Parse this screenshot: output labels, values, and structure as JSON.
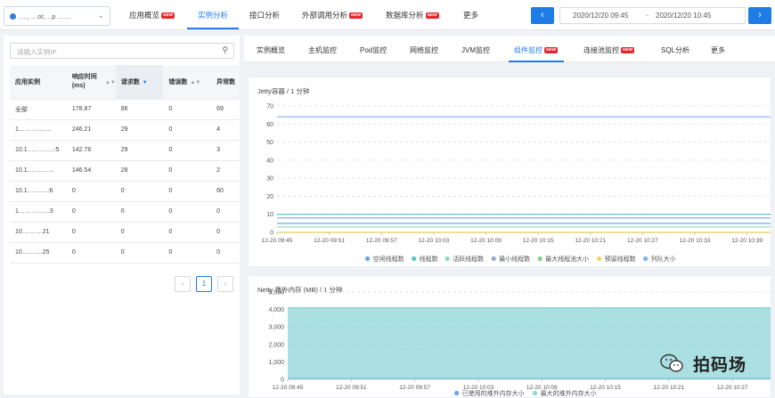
{
  "header": {
    "app_select": "…., …or,…p  ……",
    "nav": [
      {
        "label": "应用概览",
        "badge": "NEW"
      },
      {
        "label": "实例分析",
        "badge": ""
      },
      {
        "label": "接口分析",
        "badge": ""
      },
      {
        "label": "外部调用分析",
        "badge": "NEW"
      },
      {
        "label": "数据库分析",
        "badge": "NEW"
      },
      {
        "label": "更多",
        "badge": ""
      }
    ],
    "time_start": "2020/12/20 09:45",
    "time_sep": "~",
    "time_end": "2020/12/20 10:45",
    "prev_icon": "chevron-left-icon",
    "next_icon": "chevron-right-icon"
  },
  "instances": {
    "search_placeholder": "请输入实例IP",
    "columns": [
      "应用实例",
      "响应时间 (ms)",
      "请求数",
      "错误数",
      "异常数"
    ],
    "rows": [
      [
        "全部",
        "178.87",
        "86",
        "0",
        "69"
      ],
      [
        "1…………….",
        "246.21",
        "29",
        "0",
        "4"
      ],
      [
        "10.1………….:5",
        "142.76",
        "29",
        "0",
        "3"
      ],
      [
        "10.1………….",
        "146.54",
        "28",
        "0",
        "2"
      ],
      [
        "10.1……….:6",
        "0",
        "0",
        "0",
        "60"
      ],
      [
        "1……………3",
        "0",
        "0",
        "0",
        "0"
      ],
      [
        "10……….21",
        "0",
        "0",
        "0",
        "0"
      ],
      [
        "10……….25",
        "0",
        "0",
        "0",
        "0"
      ]
    ],
    "page": "1"
  },
  "subnav": [
    {
      "label": "实例概览",
      "badge": ""
    },
    {
      "label": "主机监控",
      "badge": ""
    },
    {
      "label": "Pod监控",
      "badge": ""
    },
    {
      "label": "网络监控",
      "badge": ""
    },
    {
      "label": "JVM监控",
      "badge": ""
    },
    {
      "label": "组件监控",
      "badge": "NEW"
    },
    {
      "label": "连接池监控",
      "badge": "NEW"
    },
    {
      "label": "SQL分析",
      "badge": ""
    },
    {
      "label": "更多",
      "badge": ""
    }
  ],
  "chart_data": [
    {
      "type": "line",
      "title": "Jetty容器 / 1 分钟",
      "x": [
        "12-20 09:45",
        "12-20 09:51",
        "12-20 09:57",
        "12-20 10:03",
        "12-20 10:09",
        "12-20 10:15",
        "12-20 10:21",
        "12-20 10:27",
        "12-20 10:33",
        "12-20 10:39"
      ],
      "ylim": [
        0,
        70
      ],
      "yticks": [
        0,
        10,
        20,
        30,
        40,
        50,
        60,
        70
      ],
      "grid": true,
      "legend": "bottom",
      "series": [
        {
          "name": "空闲线程数",
          "color": "#6aa8e6",
          "value": 5
        },
        {
          "name": "线程数",
          "color": "#5ec6c6",
          "value": 10
        },
        {
          "name": "活跃线程数",
          "color": "#8fdcc0",
          "value": 3
        },
        {
          "name": "最小线程数",
          "color": "#9aa6d6",
          "value": 8
        },
        {
          "name": "最大线程池大小",
          "color": "#86d08a",
          "value": 0
        },
        {
          "name": "预留线程数",
          "color": "#f2d56b",
          "value": 0
        },
        {
          "name": "列队大小",
          "color": "#7db3f0",
          "value": 64
        }
      ]
    },
    {
      "type": "area",
      "title": "Netty 堆外内存 (MB) / 1 分钟",
      "x": [
        "12-20 09:45",
        "12-20 09:51",
        "12-20 09:57",
        "12-20 10:03",
        "12-20 10:09",
        "12-20 10:15",
        "12-20 10:21",
        "12-20 10:27"
      ],
      "ylim": [
        0,
        5000
      ],
      "yticks": [
        0,
        1000,
        2000,
        3000,
        4000,
        5000
      ],
      "ytick_labels": [
        "0",
        "1,000",
        "2,000",
        "3,000",
        "4,000",
        "5,000"
      ],
      "grid": true,
      "legend": "bottom",
      "series": [
        {
          "name": "已使用的堆外内存大小",
          "color": "#6aa8e6",
          "value": 60
        },
        {
          "name": "最大的堆外内存大小",
          "color": "#8fd6d8",
          "value": 4096
        }
      ]
    }
  ],
  "watermark": {
    "text": "拍码场",
    "icon": "wechat-icon"
  }
}
